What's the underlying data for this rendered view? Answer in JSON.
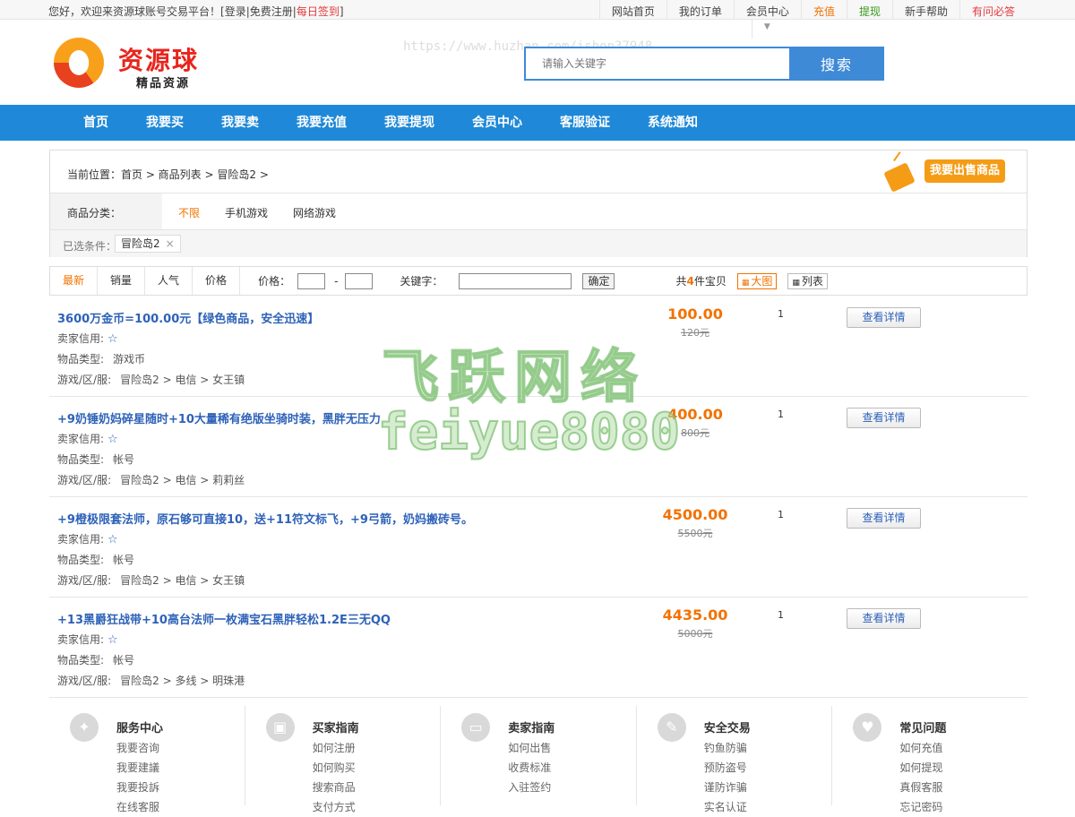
{
  "topbar": {
    "welcome": "您好，欢迎来资源球账号交易平台！",
    "login": "登录",
    "register": "免费注册",
    "signin": "每日签到",
    "links": [
      {
        "label": "网站首页",
        "style": "normal"
      },
      {
        "label": "我的订单",
        "style": "normal"
      },
      {
        "label": "会员中心",
        "style": "dropdown"
      },
      {
        "label": "充值",
        "style": "orange"
      },
      {
        "label": "提现",
        "style": "green"
      },
      {
        "label": "新手帮助",
        "style": "normal"
      },
      {
        "label": "有问必答",
        "style": "red"
      }
    ]
  },
  "logo": {
    "name": "资源球",
    "subtitle": "精品资源"
  },
  "header_watermark": "https://www.huzhan.com/ishop37948",
  "search": {
    "placeholder": "请输入关键字",
    "button": "搜索"
  },
  "nav": [
    "首页",
    "我要买",
    "我要卖",
    "我要充值",
    "我要提现",
    "会员中心",
    "客服验证",
    "系统通知"
  ],
  "breadcrumb": "当前位置：首页 > 商品列表 > 冒险岛2 >",
  "sell_button": "我要出售商品",
  "category": {
    "label": "商品分类：",
    "options": [
      "不限",
      "手机游戏",
      "网络游戏"
    ],
    "active": "不限"
  },
  "chosen": {
    "label": "已选条件：",
    "tag": "冒险岛2",
    "close": "×"
  },
  "sortbar": {
    "sorts": [
      "最新",
      "销量",
      "人气",
      "价格"
    ],
    "active_sort": "最新",
    "price_label": "价格：",
    "price_dash": "-",
    "keyword_label": "关键字：",
    "confirm": "确定",
    "total_prefix": "共",
    "total_count": "4",
    "total_suffix": "件宝贝",
    "view_large": "大图",
    "view_list": "列表"
  },
  "labels": {
    "credit": "卖家信用:",
    "type": "物品类型:",
    "server": "游戏/区/服:",
    "detail": "查看详情"
  },
  "items": [
    {
      "title": "3600万金币=100.00元【绿色商品，安全迅速】",
      "type": "游戏币",
      "server": "冒险岛2 > 电信 > 女王镇",
      "price": "100.00",
      "old_price": "120元",
      "qty": "1"
    },
    {
      "title": "+9奶锤奶妈碎星随时+10大量稀有绝版坐骑时装，黑胖无压力",
      "type": "帐号",
      "server": "冒险岛2 > 电信 > 莉莉丝",
      "price": "400.00",
      "old_price": "800元",
      "qty": "1"
    },
    {
      "title": "+9橙极限套法师，原石够可直接10，送+11符文标飞，+9弓箭，奶妈搬砖号。",
      "type": "帐号",
      "server": "冒险岛2 > 电信 > 女王镇",
      "price": "4500.00",
      "old_price": "5500元",
      "qty": "1"
    },
    {
      "title": "+13黑爵狂战带+10高台法师一枚满宝石黑胖轻松1.2E三无QQ",
      "type": "帐号",
      "server": "冒险岛2 > 多线 > 明珠港",
      "price": "4435.00",
      "old_price": "5000元",
      "qty": "1"
    }
  ],
  "footer": [
    {
      "icon": "compass-icon",
      "title": "服务中心",
      "links": [
        "我要咨询",
        "我要建議",
        "我要投訴",
        "在线客服"
      ]
    },
    {
      "icon": "bus-icon",
      "title": "买家指南",
      "links": [
        "如何注册",
        "如何购买",
        "搜索商品",
        "支付方式"
      ]
    },
    {
      "icon": "wallet-icon",
      "title": "卖家指南",
      "links": [
        "如何出售",
        "收费标准",
        "入驻签约"
      ]
    },
    {
      "icon": "wrench-icon",
      "title": "安全交易",
      "links": [
        "钓鱼防骗",
        "预防盗号",
        "谨防诈骗",
        "实名认证"
      ]
    },
    {
      "icon": "heart-icon",
      "title": "常见问题",
      "links": [
        "如何充值",
        "如何提现",
        "真假客服",
        "忘记密码"
      ]
    }
  ],
  "watermark": {
    "line1": "飞跃网络",
    "line2": "feiyue8080"
  }
}
